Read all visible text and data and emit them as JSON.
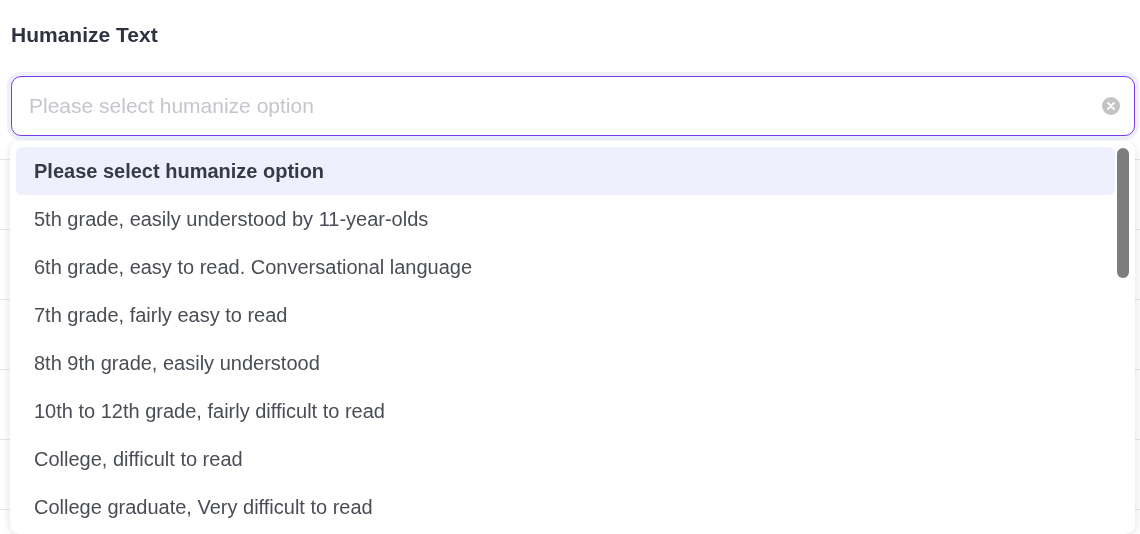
{
  "title": "Humanize Text",
  "select": {
    "placeholder": "Please select humanize option"
  },
  "options": [
    {
      "label": "Please select humanize option",
      "selected": true
    },
    {
      "label": "5th grade, easily understood by 11-year-olds",
      "selected": false
    },
    {
      "label": "6th grade, easy to read. Conversational language",
      "selected": false
    },
    {
      "label": "7th grade, fairly easy to read",
      "selected": false
    },
    {
      "label": "8th 9th grade, easily understood",
      "selected": false
    },
    {
      "label": "10th to 12th grade, fairly difficult to read",
      "selected": false
    },
    {
      "label": "College, difficult to read",
      "selected": false
    },
    {
      "label": "College graduate, Very difficult to read",
      "selected": false
    }
  ]
}
